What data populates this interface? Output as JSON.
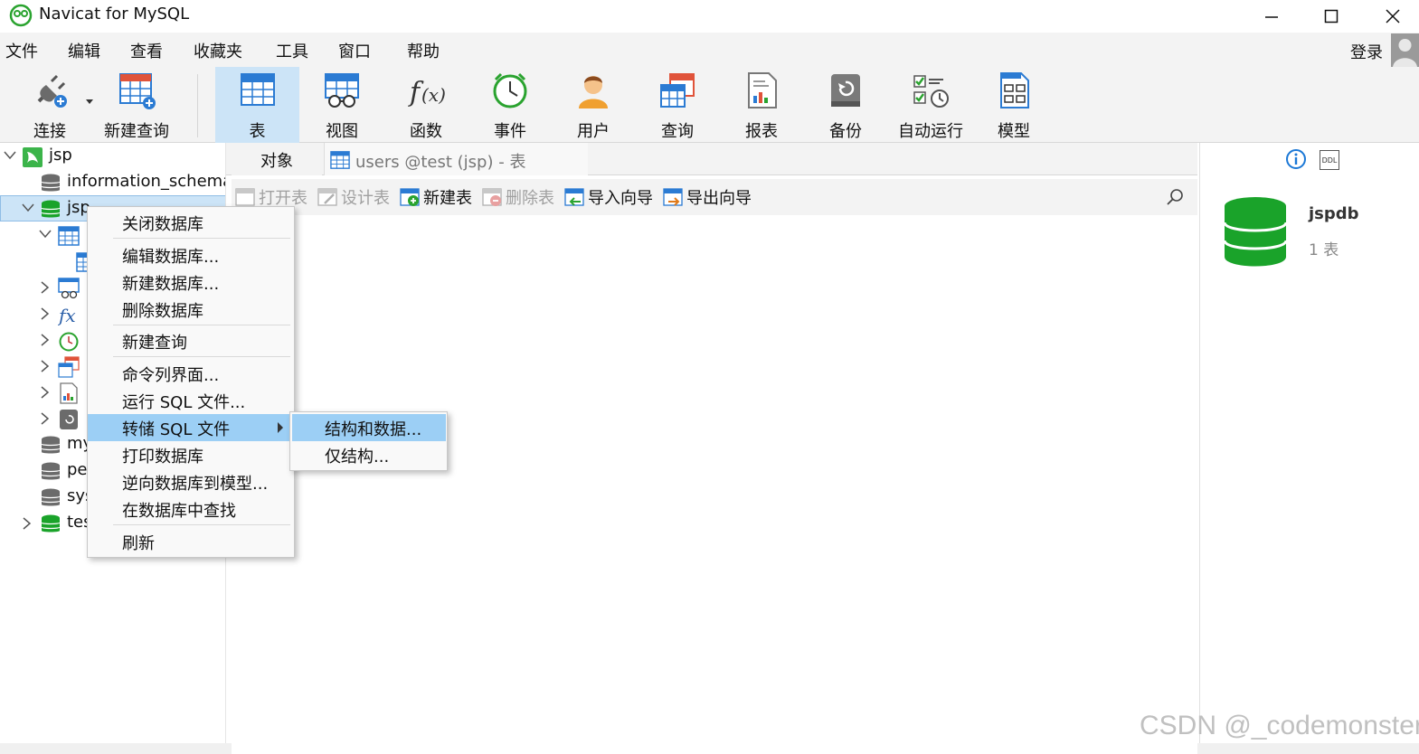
{
  "window": {
    "title": "Navicat for MySQL"
  },
  "menu": [
    "文件",
    "编辑",
    "查看",
    "收藏夹",
    "工具",
    "窗口",
    "帮助"
  ],
  "login_label": "登录",
  "toolbar": {
    "connect": "连接",
    "new_query": "新建查询",
    "table": "表",
    "view": "视图",
    "function": "函数",
    "event": "事件",
    "user": "用户",
    "query": "查询",
    "report": "报表",
    "backup": "备份",
    "automation": "自动运行",
    "model": "模型"
  },
  "tree": {
    "connection": "jsp",
    "databases": {
      "information_schema": "information_schema",
      "jspdb": "jsp",
      "mysql": "my",
      "performance": "pe",
      "sys": "sys",
      "test": "tes"
    }
  },
  "tabs": {
    "objects": "对象",
    "users_tab": "users @test (jsp) - 表"
  },
  "object_bar": {
    "open_table": "打开表",
    "design_table": "设计表",
    "new_table": "新建表",
    "delete_table": "删除表",
    "import_wizard": "导入向导",
    "export_wizard": "导出向导"
  },
  "context_menu": {
    "close_db": "关闭数据库",
    "edit_db": "编辑数据库...",
    "new_db": "新建数据库...",
    "delete_db": "删除数据库",
    "new_query": "新建查询",
    "console": "命令列界面...",
    "run_sql": "运行 SQL 文件...",
    "dump_sql": "转储 SQL 文件",
    "print_db": "打印数据库",
    "reverse_model": "逆向数据库到模型...",
    "find_in_db": "在数据库中查找",
    "refresh": "刷新"
  },
  "submenu": {
    "structure_data": "结构和数据...",
    "structure_only": "仅结构..."
  },
  "info_panel": {
    "db_name": "jspdb",
    "table_count": "1 表",
    "ddl_label": "DDL"
  },
  "watermark": "CSDN @_codemonster",
  "colors": {
    "accent": "#cce4f7",
    "highlight": "#9ccff5",
    "db_green": "#1aa32a",
    "db_gray": "#6b6b6b"
  }
}
